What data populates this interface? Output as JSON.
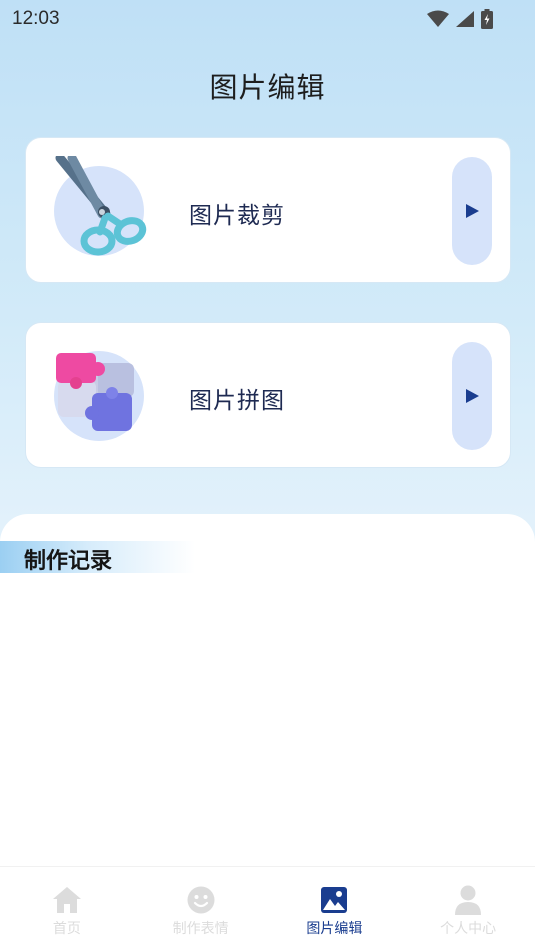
{
  "status_bar": {
    "time": "12:03"
  },
  "header": {
    "title": "图片编辑"
  },
  "cards": [
    {
      "label": "图片裁剪",
      "icon": "scissors-icon"
    },
    {
      "label": "图片拼图",
      "icon": "puzzle-icon"
    }
  ],
  "history": {
    "title": "制作记录"
  },
  "tabbar": {
    "items": [
      {
        "label": "首页",
        "icon": "home-icon",
        "active": false
      },
      {
        "label": "制作表情",
        "icon": "smiley-icon",
        "active": false
      },
      {
        "label": "图片编辑",
        "icon": "image-icon",
        "active": true
      },
      {
        "label": "个人中心",
        "icon": "user-icon",
        "active": false
      }
    ]
  },
  "colors": {
    "accent": "#1a3d8f",
    "card_icon_bg": "#d6e3fa",
    "inactive_tab": "#dcdcdc"
  }
}
